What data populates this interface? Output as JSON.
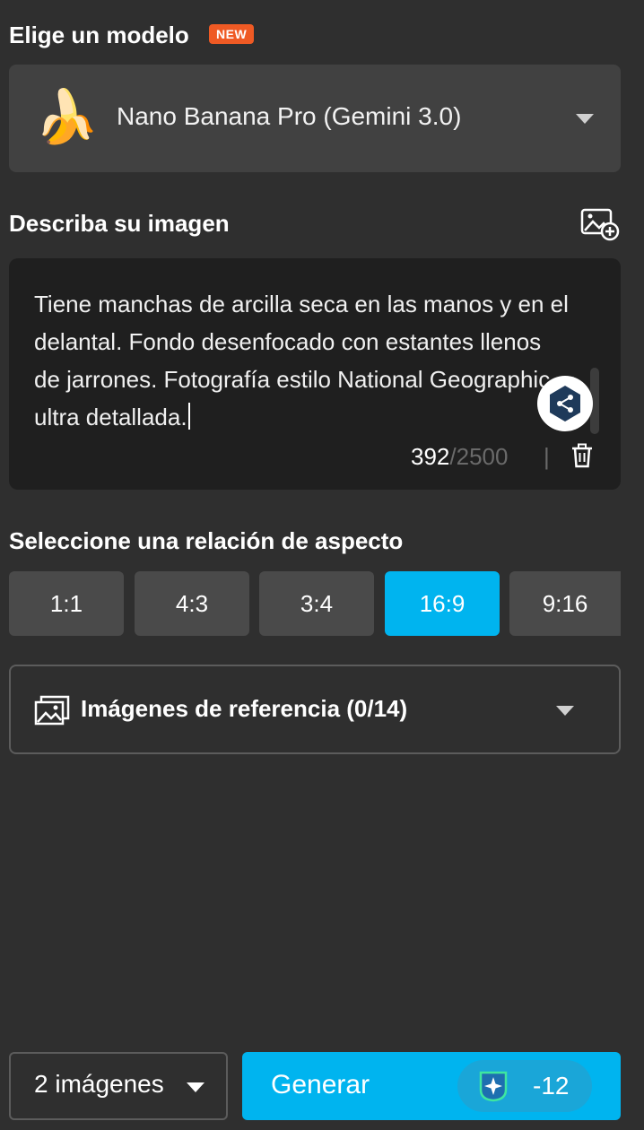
{
  "model_section": {
    "title": "Elige un modelo",
    "badge": "NEW",
    "selected_model": "Nano Banana Pro (Gemini 3.0)",
    "model_icon": "banana-emoji",
    "banana_glyph": "🍌"
  },
  "prompt_section": {
    "title": "Describa su imagen",
    "text": "Tiene manchas de arcilla seca en las manos y en el delantal. Fondo desenfocado con estantes llenos de jarrones. Fotografía estilo National Geographic, ultra detallada.",
    "char_count": "392",
    "char_max": "/2500",
    "separator": "|"
  },
  "aspect_section": {
    "title": "Seleccione una relación de aspecto",
    "options": [
      "1:1",
      "4:3",
      "3:4",
      "16:9",
      "9:16"
    ],
    "selected": "16:9"
  },
  "reference_section": {
    "label": "Imágenes de referencia (0/14)"
  },
  "footer": {
    "image_count": "2 imágenes",
    "generate_label": "Generar",
    "credit_cost": "-12"
  },
  "colors": {
    "background": "#2f2f2f",
    "accent": "#00b4ef",
    "badge": "#ef5a24"
  }
}
